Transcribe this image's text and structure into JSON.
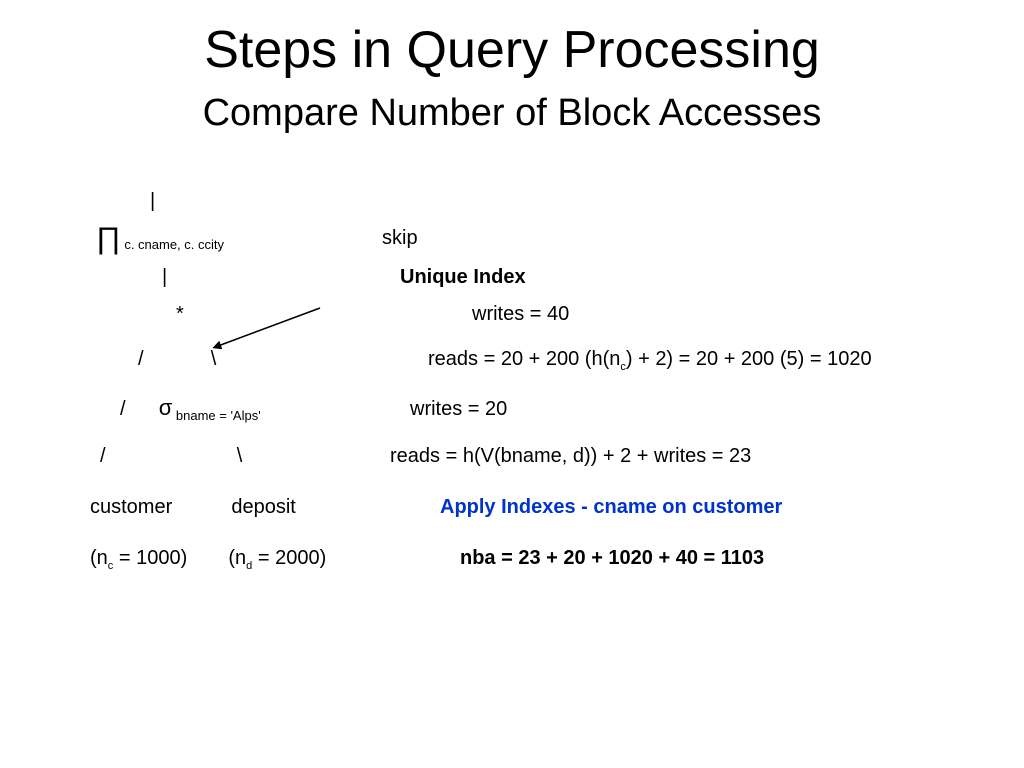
{
  "title": "Steps in Query Processing",
  "subtitle": "Compare Number of Block Accesses",
  "tree": {
    "pipe1": "|",
    "proj": {
      "symbol": "∏",
      "sub": " c. cname, c. ccity"
    },
    "skip": "skip",
    "pipe2": "|",
    "unique_index": "Unique Index",
    "star": "*",
    "writes40": "writes = 40",
    "slashback1": {
      "left": "/",
      "right": "\\"
    },
    "reads1020": "reads = 20 + 200 (h(n",
    "reads1020_sub": "c",
    "reads1020_cont": ") + 2) = 20 + 200 (5) = 1020",
    "slash2": "/",
    "sigma": {
      "symbol": "σ",
      "sub": " bname = 'Alps'"
    },
    "writes20": "writes = 20",
    "slashback3": {
      "left": "/",
      "right": "\\"
    },
    "reads23": "reads = h(V(bname, d)) + 2 + writes = 23",
    "customer": "customer",
    "deposit": "deposit",
    "apply_idx": "Apply Indexes - cname on customer",
    "nc": {
      "pre": "(n",
      "sub": "c",
      "post": " = 1000)"
    },
    "nd": {
      "pre": "(n",
      "sub": "d",
      "post": " = 2000)"
    },
    "nba": "nba = 23 + 20 + 1020 + 40 = 1103"
  }
}
